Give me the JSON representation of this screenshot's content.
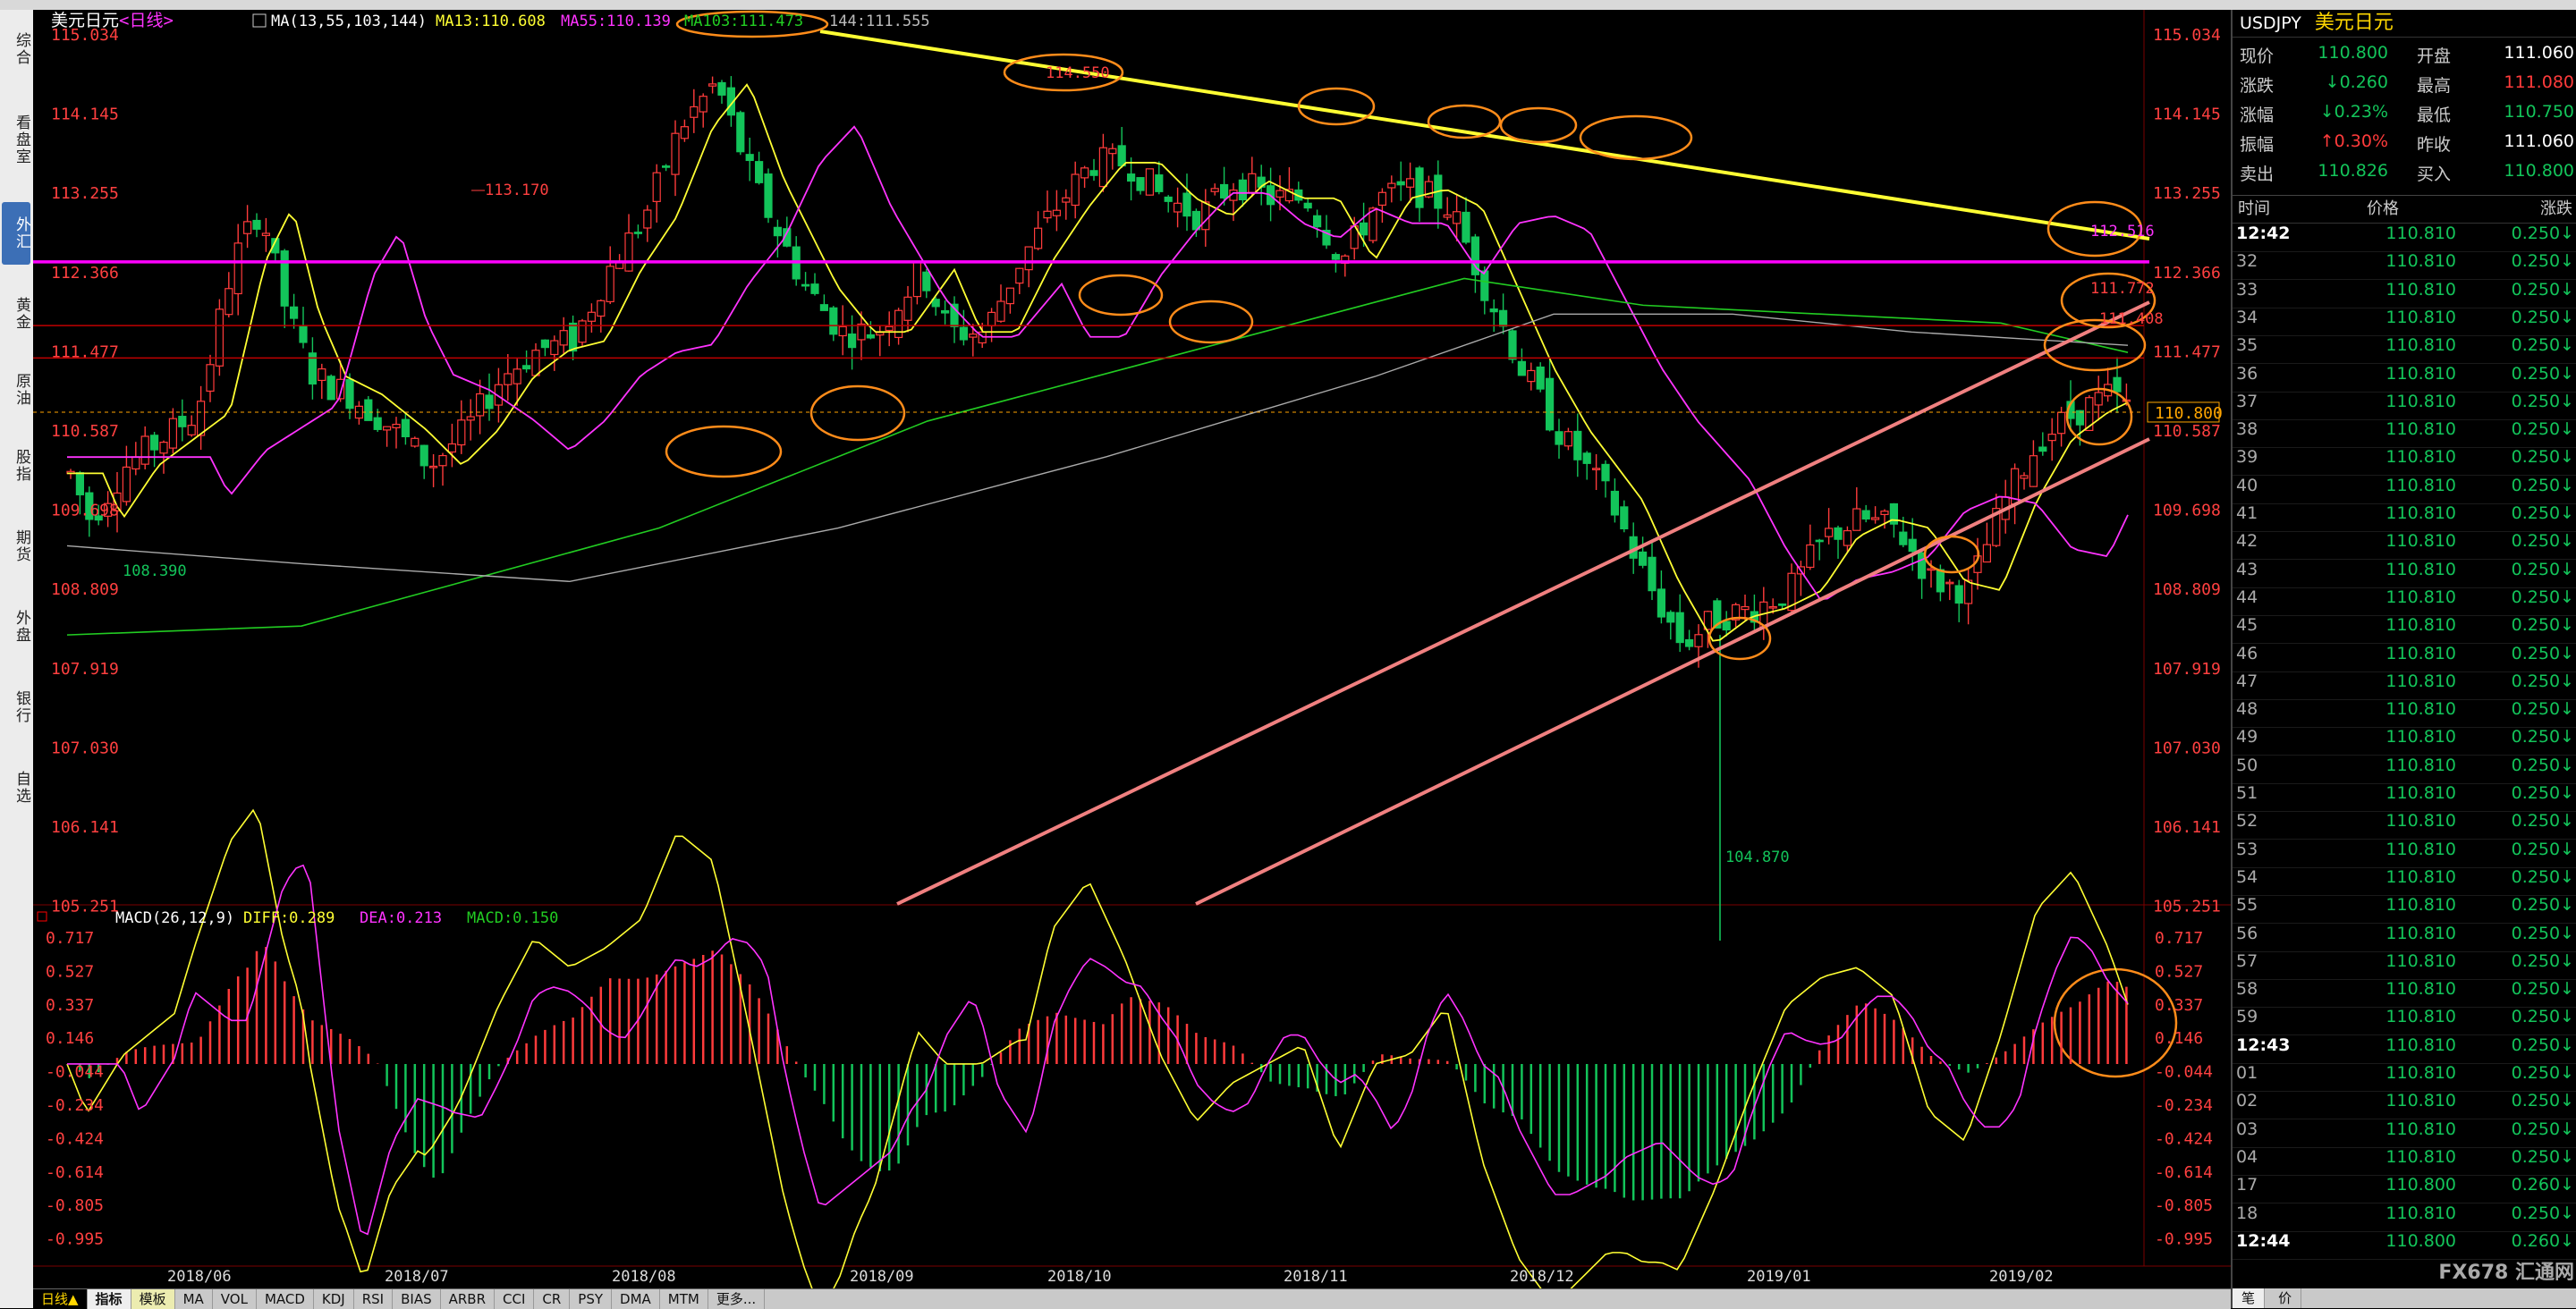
{
  "left_tabs": [
    "综合",
    "看盘室",
    "外汇",
    "黄金",
    "原油",
    "股指",
    "期货",
    "外盘",
    "银行",
    "自选"
  ],
  "active_tab": 2,
  "chart": {
    "header_title": "美元日元",
    "header_period": "<日线>",
    "ma_label": "MA(13,55,103,144)",
    "ma13": "MA13:110.608",
    "ma55": "MA55:110.139",
    "ma103": "MA103:111.473",
    "ma144": "144:111.555",
    "price_ticks": [
      "115.034",
      "114.145",
      "113.255",
      "112.366",
      "111.477",
      "110.587",
      "109.698",
      "108.809",
      "107.919",
      "107.030",
      "106.141",
      "105.251"
    ],
    "current_price_tag": "110.800",
    "annot_high": "113.170",
    "annot_low_start": "108.390",
    "annot_low_flash": "104.870",
    "annot_top_partial": "114.550",
    "annot_112_516": "112.516",
    "annot_111_772": "111.772",
    "annot_111_408": "111.408",
    "macd_label": "MACD(26,12,9)",
    "macd_diff": "DIFF:0.289",
    "macd_dea": "DEA:0.213",
    "macd_macd": "MACD:0.150",
    "macd_ticks": [
      "0.717",
      "0.527",
      "0.337",
      "0.146",
      "-0.044",
      "-0.234",
      "-0.424",
      "-0.614",
      "-0.805",
      "-0.995"
    ],
    "date_labels": [
      "2018/06",
      "2018/07",
      "2018/08",
      "2018/09",
      "2018/10",
      "2018/11",
      "2018/12",
      "2019/01",
      "2019/02"
    ],
    "period_button": "日线▲",
    "colors": {
      "up": "#ff3b3b",
      "down": "#13c45a",
      "ma13": "#ffff33",
      "ma55": "#ff33ff",
      "ma103": "#22cc22",
      "ma144": "#aaaaaa",
      "trend_yellow": "#ffff33",
      "channel": "#f08080",
      "magenta_line": "#ff00ff",
      "circle": "#ff8c1a"
    }
  },
  "bottom_tabs": [
    "指标",
    "模板",
    "MA",
    "VOL",
    "MACD",
    "KDJ",
    "RSI",
    "BIAS",
    "ARBR",
    "CCI",
    "CR",
    "PSY",
    "DMA",
    "MTM",
    "更多..."
  ],
  "right_panel": {
    "code": "USDJPY",
    "name": "美元日元",
    "quote": [
      {
        "l1": "现价",
        "v1": "110.800",
        "c1": "#13c45a",
        "l2": "开盘",
        "v2": "111.060",
        "c2": "#fff"
      },
      {
        "l1": "涨跌",
        "v1": "↓0.260",
        "c1": "#13c45a",
        "l2": "最高",
        "v2": "111.080",
        "c2": "#ff3b3b"
      },
      {
        "l1": "涨幅",
        "v1": "↓0.23%",
        "c1": "#13c45a",
        "l2": "最低",
        "v2": "110.750",
        "c2": "#13c45a"
      },
      {
        "l1": "振幅",
        "v1": "↑0.30%",
        "c1": "#ff3b3b",
        "l2": "昨收",
        "v2": "111.060",
        "c2": "#fff"
      },
      {
        "l1": "卖出",
        "v1": "110.826",
        "c1": "#13c45a",
        "l2": "买入",
        "v2": "110.800",
        "c2": "#13c45a"
      }
    ],
    "tick_headers": [
      "时间",
      "价格",
      "涨跌"
    ],
    "ticks": [
      {
        "t": "12:42",
        "p": "110.810",
        "c": "0.250↓"
      },
      {
        "t": "32",
        "p": "110.810",
        "c": "0.250↓"
      },
      {
        "t": "33",
        "p": "110.810",
        "c": "0.250↓"
      },
      {
        "t": "34",
        "p": "110.810",
        "c": "0.250↓"
      },
      {
        "t": "35",
        "p": "110.810",
        "c": "0.250↓"
      },
      {
        "t": "36",
        "p": "110.810",
        "c": "0.250↓"
      },
      {
        "t": "37",
        "p": "110.810",
        "c": "0.250↓"
      },
      {
        "t": "38",
        "p": "110.810",
        "c": "0.250↓"
      },
      {
        "t": "39",
        "p": "110.810",
        "c": "0.250↓"
      },
      {
        "t": "40",
        "p": "110.810",
        "c": "0.250↓"
      },
      {
        "t": "41",
        "p": "110.810",
        "c": "0.250↓"
      },
      {
        "t": "42",
        "p": "110.810",
        "c": "0.250↓"
      },
      {
        "t": "43",
        "p": "110.810",
        "c": "0.250↓"
      },
      {
        "t": "44",
        "p": "110.810",
        "c": "0.250↓"
      },
      {
        "t": "45",
        "p": "110.810",
        "c": "0.250↓"
      },
      {
        "t": "46",
        "p": "110.810",
        "c": "0.250↓"
      },
      {
        "t": "47",
        "p": "110.810",
        "c": "0.250↓"
      },
      {
        "t": "48",
        "p": "110.810",
        "c": "0.250↓"
      },
      {
        "t": "49",
        "p": "110.810",
        "c": "0.250↓"
      },
      {
        "t": "50",
        "p": "110.810",
        "c": "0.250↓"
      },
      {
        "t": "51",
        "p": "110.810",
        "c": "0.250↓"
      },
      {
        "t": "52",
        "p": "110.810",
        "c": "0.250↓"
      },
      {
        "t": "53",
        "p": "110.810",
        "c": "0.250↓"
      },
      {
        "t": "54",
        "p": "110.810",
        "c": "0.250↓"
      },
      {
        "t": "55",
        "p": "110.810",
        "c": "0.250↓"
      },
      {
        "t": "56",
        "p": "110.810",
        "c": "0.250↓"
      },
      {
        "t": "57",
        "p": "110.810",
        "c": "0.250↓"
      },
      {
        "t": "58",
        "p": "110.810",
        "c": "0.250↓"
      },
      {
        "t": "59",
        "p": "110.810",
        "c": "0.250↓"
      },
      {
        "t": "12:43",
        "p": "110.810",
        "c": "0.250↓"
      },
      {
        "t": "01",
        "p": "110.810",
        "c": "0.250↓"
      },
      {
        "t": "02",
        "p": "110.810",
        "c": "0.250↓"
      },
      {
        "t": "03",
        "p": "110.810",
        "c": "0.250↓"
      },
      {
        "t": "04",
        "p": "110.810",
        "c": "0.250↓"
      },
      {
        "t": "17",
        "p": "110.800",
        "c": "0.260↓"
      },
      {
        "t": "18",
        "p": "110.810",
        "c": "0.250↓"
      },
      {
        "t": "12:44",
        "p": "110.800",
        "c": "0.260↓"
      }
    ],
    "bottom_tabs": [
      "笔",
      "价"
    ],
    "watermark": "FX678 汇通网"
  }
}
